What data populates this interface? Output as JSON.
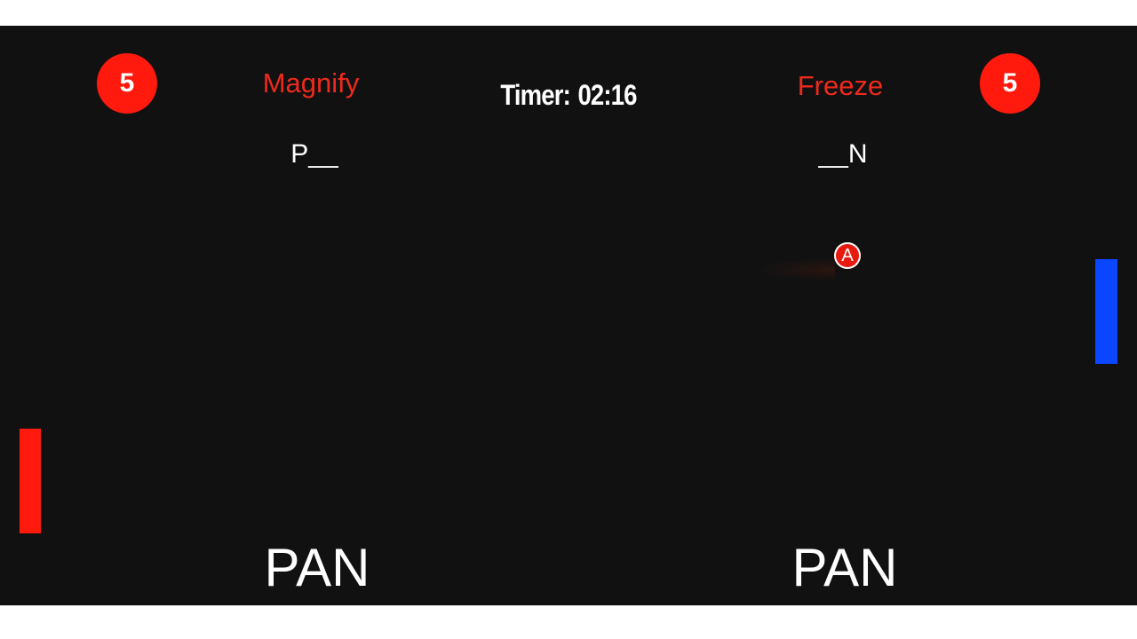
{
  "left_player": {
    "score": "5",
    "powerup": "Magnify",
    "hint": "P__",
    "word": "PAN",
    "paddle_color": "#ff1a0d"
  },
  "right_player": {
    "score": "5",
    "powerup": "Freeze",
    "hint": "__N",
    "word": "PAN",
    "paddle_color": "#0a46ff"
  },
  "timer": {
    "label": "Timer:",
    "value": "02:16"
  },
  "ball": {
    "letter": "A",
    "color": "#e8190f"
  },
  "colors": {
    "background": "#111112",
    "accent": "#ff1a0d"
  }
}
